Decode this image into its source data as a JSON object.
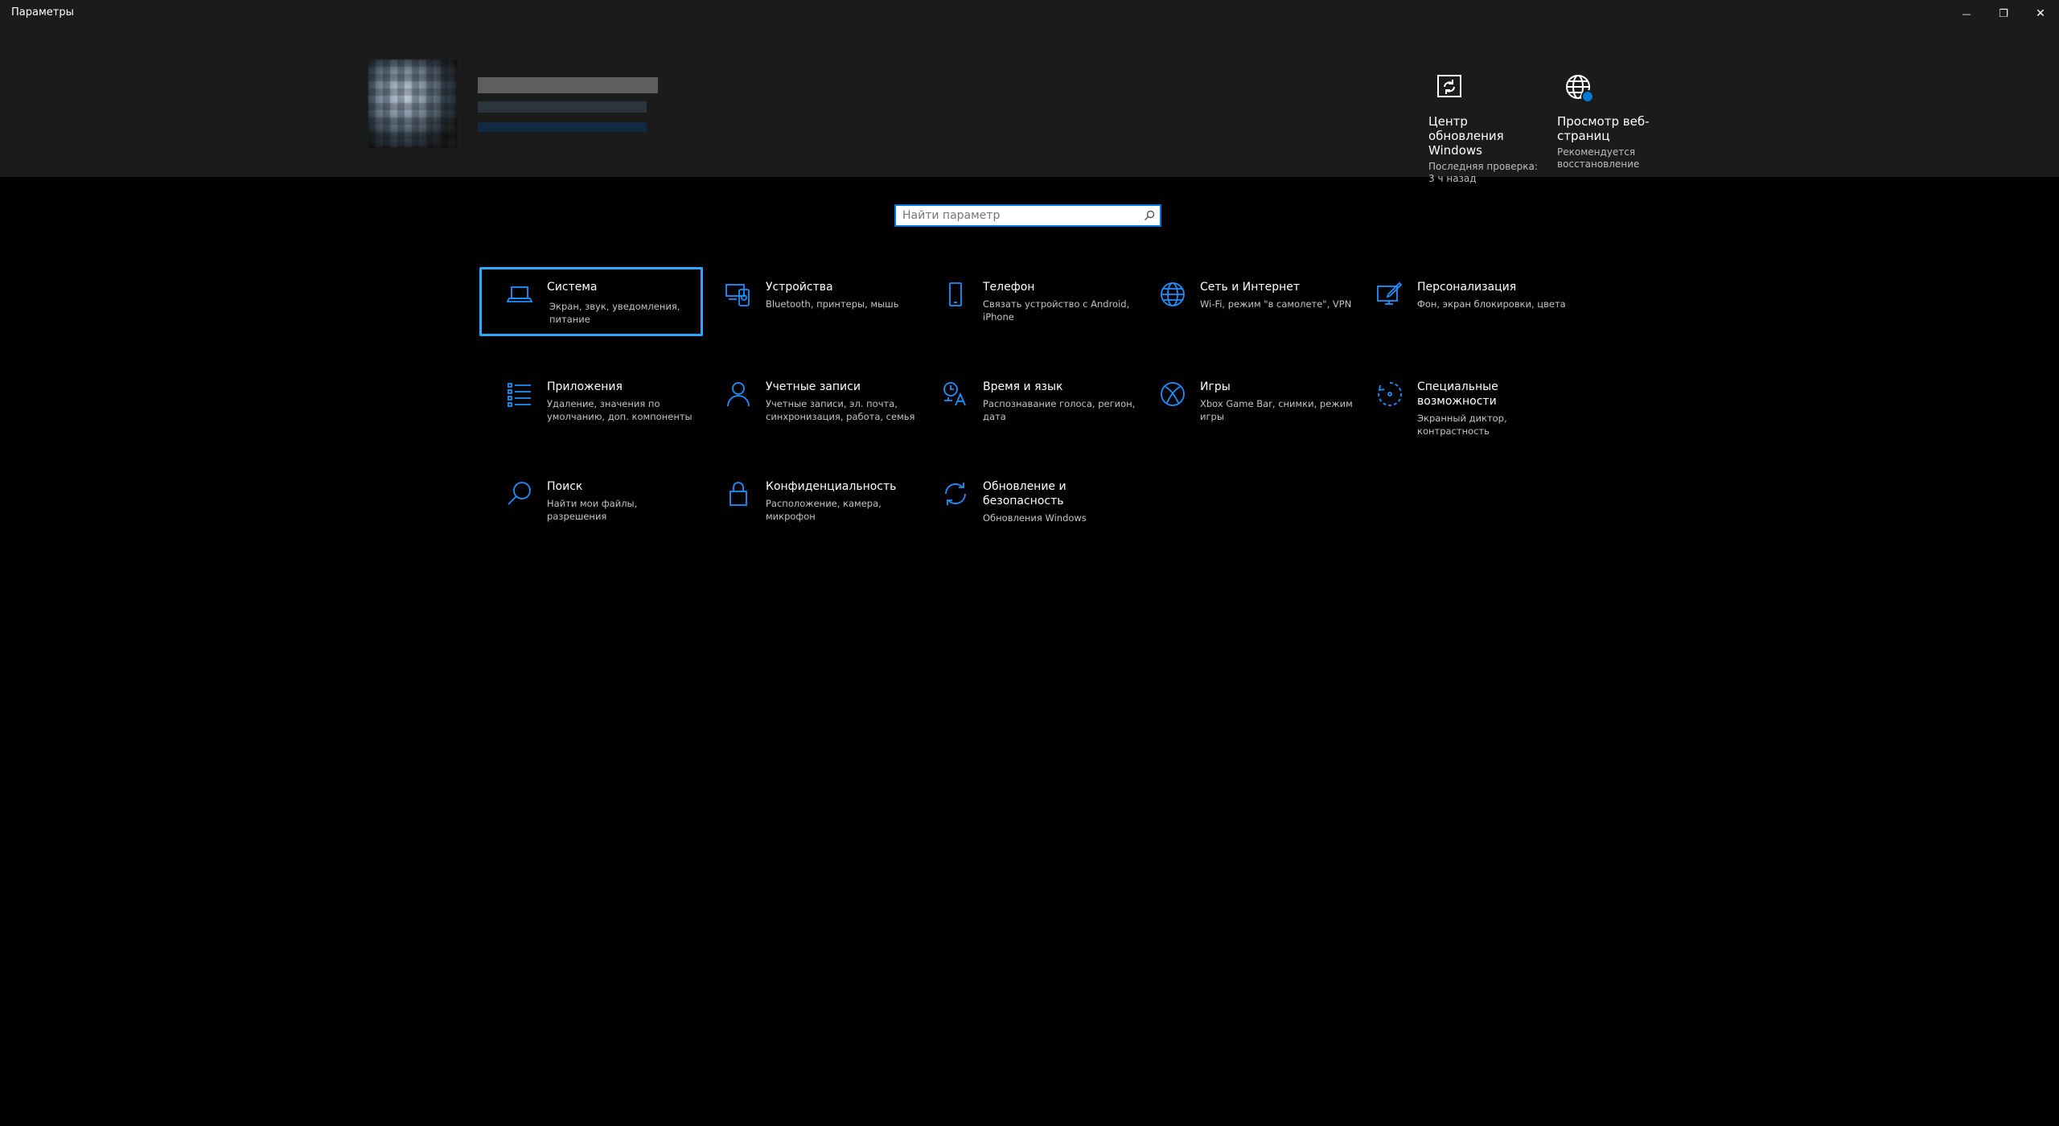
{
  "window": {
    "title": "Параметры",
    "minimize_glyph": "—",
    "restore_glyph": "❐",
    "close_glyph": "✕"
  },
  "quick_links": [
    {
      "icon": "sync-icon",
      "title": "Центр обновления Windows",
      "subtitle": "Последняя проверка: 3 ч назад"
    },
    {
      "icon": "globe-icon",
      "title": "Просмотр веб-страниц",
      "subtitle": "Рекомендуется восстановление"
    }
  ],
  "search": {
    "placeholder": "Найти параметр",
    "value": ""
  },
  "categories": [
    {
      "icon": "laptop-icon",
      "name": "Система",
      "desc": "Экран, звук, уведомления, питание"
    },
    {
      "icon": "devices-icon",
      "name": "Устройства",
      "desc": "Bluetooth, принтеры, мышь"
    },
    {
      "icon": "phone-icon",
      "name": "Телефон",
      "desc": "Связать устройство с Android, iPhone"
    },
    {
      "icon": "globe-icon",
      "name": "Сеть и Интернет",
      "desc": "Wi-Fi, режим \"в самолете\", VPN"
    },
    {
      "icon": "personalization-icon",
      "name": "Персонализация",
      "desc": "Фон, экран блокировки, цвета"
    },
    {
      "icon": "apps-list-icon",
      "name": "Приложения",
      "desc": "Удаление, значения по умолчанию, доп. компоненты"
    },
    {
      "icon": "person-icon",
      "name": "Учетные записи",
      "desc": "Учетные записи, эл. почта, синхронизация, работа, семья"
    },
    {
      "icon": "time-language-icon",
      "name": "Время и язык",
      "desc": "Распознавание голоса, регион, дата"
    },
    {
      "icon": "xbox-icon",
      "name": "Игры",
      "desc": "Xbox Game Bar, снимки, режим игры"
    },
    {
      "icon": "ease-of-access-icon",
      "name": "Специальные возможности",
      "desc": "Экранный диктор, контрастность"
    },
    {
      "icon": "search-icon",
      "name": "Поиск",
      "desc": "Найти мои файлы, разрешения"
    },
    {
      "icon": "lock-icon",
      "name": "Конфиденциальность",
      "desc": "Расположение, камера, микрофон"
    },
    {
      "icon": "update-icon",
      "name": "Обновление и безопасность",
      "desc": "Обновления Windows"
    }
  ],
  "colors": {
    "accent": "#0078d7",
    "focus": "#2ea8ff",
    "header_bg": "#1b1b1b",
    "bg": "#000000"
  }
}
